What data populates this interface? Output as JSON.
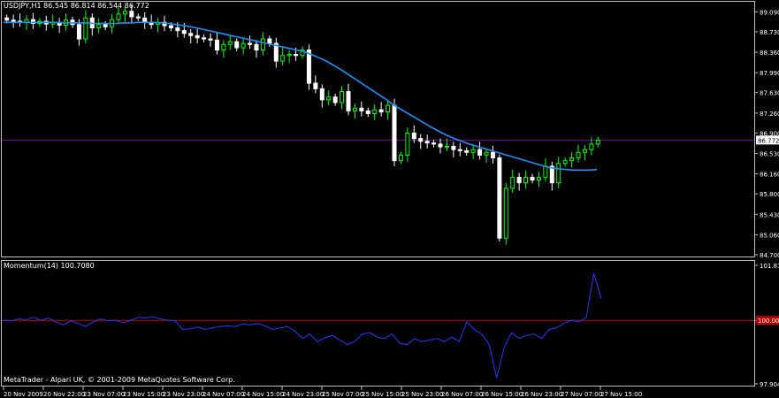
{
  "header": {
    "symbol_info": "USDJPY,H1  86.545 86.814 86.544 86.772"
  },
  "indicator": {
    "label": "Momentum(14) 100.7080"
  },
  "footer": {
    "copyright": "MetaTrader - Alpari UK, © 2001-2009 MetaQuotes Software Corp."
  },
  "colors": {
    "background": "#000000",
    "grid_text": "#ffffff",
    "bull_candle": "#00ff00",
    "bear_candle": "#ffffff",
    "moving_average": "#1e90ff",
    "price_line": "#7b00a8",
    "level_line": "#c00000",
    "momentum_line": "#1e3cff"
  },
  "chart_data": [
    {
      "type": "candlestick",
      "price_axis_ticks": [
        "89.090",
        "88.730",
        "88.360",
        "87.990",
        "87.630",
        "87.260",
        "86.900",
        "86.530",
        "86.160",
        "85.800",
        "85.430",
        "85.060",
        "84.700"
      ],
      "ylim": [
        84.7,
        89.24
      ],
      "current_price": "86.772",
      "time_labels": [
        "20 Nov 2009",
        "20 Nov 22:00",
        "23 Nov 07:00",
        "23 Nov 15:00",
        "23 Nov 23:00",
        "24 Nov 07:00",
        "24 Nov 15:00",
        "24 Nov 23:00",
        "25 Nov 07:00",
        "25 Nov 15:00",
        "25 Nov 23:00",
        "26 Nov 07:00",
        "26 Nov 15:00",
        "26 Nov 23:00",
        "27 Nov 07:00",
        "27 Nov 15:00"
      ],
      "close_series": [
        88.94,
        88.92,
        88.9,
        88.95,
        88.88,
        88.92,
        88.87,
        88.9,
        88.85,
        88.94,
        88.86,
        88.6,
        88.98,
        88.8,
        88.86,
        88.82,
        88.95,
        89.05,
        89.1,
        89.0,
        88.98,
        88.9,
        88.86,
        88.9,
        88.84,
        88.8,
        88.75,
        88.7,
        88.66,
        88.62,
        88.6,
        88.58,
        88.4,
        88.5,
        88.55,
        88.44,
        88.52,
        88.5,
        88.4,
        88.6,
        88.52,
        88.2,
        88.3,
        88.32,
        88.3,
        88.4,
        87.8,
        87.7,
        87.5,
        87.55,
        87.45,
        87.65,
        87.3,
        87.35,
        87.3,
        87.25,
        87.32,
        87.28,
        87.4,
        86.4,
        86.5,
        86.9,
        86.8,
        86.75,
        86.72,
        86.7,
        86.65,
        86.66,
        86.6,
        86.58,
        86.55,
        86.6,
        86.5,
        86.55,
        86.45,
        85.0,
        85.9,
        86.1,
        86.0,
        86.1,
        86.05,
        86.1,
        86.3,
        86.0,
        86.35,
        86.4,
        86.45,
        86.55,
        86.6,
        86.7,
        86.772
      ],
      "ma_series": [
        88.9,
        88.9,
        88.9,
        88.9,
        88.9,
        88.9,
        88.9,
        88.9,
        88.89,
        88.89,
        88.89,
        88.89,
        88.88,
        88.88,
        88.88,
        88.88,
        88.89,
        88.89,
        88.9,
        88.9,
        88.9,
        88.89,
        88.88,
        88.86,
        88.84,
        88.82,
        88.79,
        88.76,
        88.73,
        88.7,
        88.67,
        88.64,
        88.61,
        88.58,
        88.55,
        88.52,
        88.49,
        88.46,
        88.43,
        88.4,
        88.37,
        88.32,
        88.26,
        88.2,
        88.12,
        88.04,
        87.95,
        87.86,
        87.77,
        87.68,
        87.59,
        87.5,
        87.4,
        87.32,
        87.24,
        87.16,
        87.08,
        87.0,
        86.93,
        86.86,
        86.8,
        86.75,
        86.7,
        86.66,
        86.62,
        86.58,
        86.54,
        86.5,
        86.46,
        86.42,
        86.38,
        86.34,
        86.3,
        86.27,
        86.25,
        86.24,
        86.23,
        86.23,
        86.23,
        86.24
      ]
    },
    {
      "type": "line",
      "name": "Momentum(14)",
      "axis_ticks": [
        "101.817",
        "100.000",
        "97.9042"
      ],
      "ylim": [
        97.9042,
        101.817
      ],
      "level": 100.0,
      "values": [
        100.0,
        99.98,
        100.05,
        100.02,
        100.1,
        100.0,
        100.08,
        99.95,
        99.85,
        99.98,
        99.9,
        99.8,
        99.95,
        100.05,
        99.98,
        100.0,
        99.92,
        100.0,
        100.1,
        100.08,
        100.12,
        100.05,
        100.0,
        99.98,
        99.7,
        99.72,
        99.78,
        99.7,
        99.75,
        99.8,
        99.82,
        99.8,
        99.88,
        99.85,
        99.9,
        99.82,
        99.7,
        99.75,
        99.8,
        99.65,
        99.4,
        99.55,
        99.3,
        99.42,
        99.5,
        99.35,
        99.2,
        99.3,
        99.55,
        99.6,
        99.45,
        99.4,
        99.55,
        99.25,
        99.2,
        99.4,
        99.3,
        99.35,
        99.4,
        99.3,
        99.45,
        99.3,
        99.95,
        99.7,
        99.55,
        99.2,
        98.1,
        99.1,
        99.6,
        99.4,
        99.5,
        99.55,
        99.4,
        99.7,
        99.75,
        99.9,
        100.0,
        99.95,
        100.1,
        101.55,
        100.71
      ]
    }
  ]
}
